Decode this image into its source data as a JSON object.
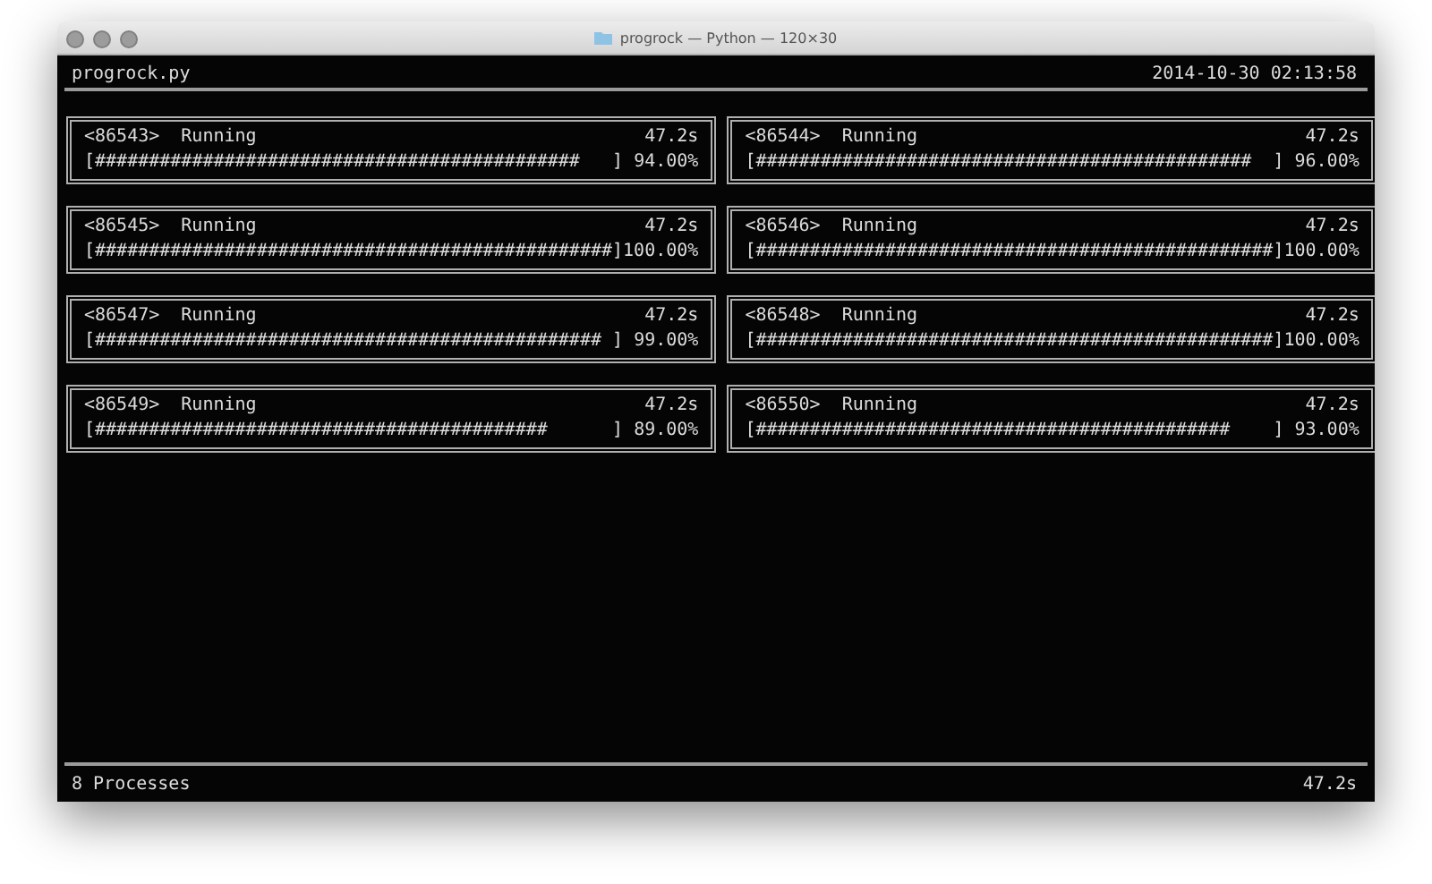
{
  "window": {
    "title": "progrock — Python — 120×30"
  },
  "header": {
    "script": "progrock.py",
    "timestamp": "2014-10-30 02:13:58"
  },
  "processes": [
    {
      "pid": "<86543>",
      "status": "Running",
      "time": "47.2s",
      "bar": "[#############################################   ]",
      "percent": "94.00%"
    },
    {
      "pid": "<86544>",
      "status": "Running",
      "time": "47.2s",
      "bar": "[##############################################  ]",
      "percent": "96.00%"
    },
    {
      "pid": "<86545>",
      "status": "Running",
      "time": "47.2s",
      "bar": "[################################################]",
      "percent": "100.00%"
    },
    {
      "pid": "<86546>",
      "status": "Running",
      "time": "47.2s",
      "bar": "[################################################]",
      "percent": "100.00%"
    },
    {
      "pid": "<86547>",
      "status": "Running",
      "time": "47.2s",
      "bar": "[############################################### ]",
      "percent": "99.00%"
    },
    {
      "pid": "<86548>",
      "status": "Running",
      "time": "47.2s",
      "bar": "[################################################]",
      "percent": "100.00%"
    },
    {
      "pid": "<86549>",
      "status": "Running",
      "time": "47.2s",
      "bar": "[##########################################      ]",
      "percent": "89.00%"
    },
    {
      "pid": "<86550>",
      "status": "Running",
      "time": "47.2s",
      "bar": "[############################################    ]",
      "percent": "93.00%"
    }
  ],
  "footer": {
    "count": "8 Processes",
    "elapsed": "47.2s"
  }
}
